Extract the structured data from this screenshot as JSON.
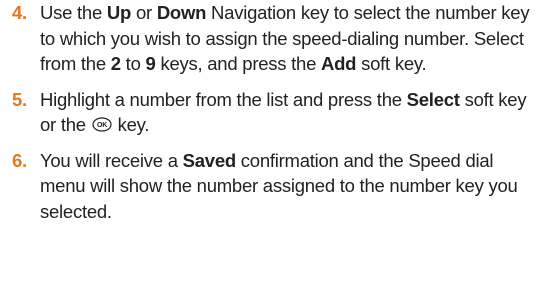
{
  "steps": [
    {
      "number": "4.",
      "parts": [
        {
          "text": "Use the ",
          "bold": false
        },
        {
          "text": "Up",
          "bold": true
        },
        {
          "text": " or ",
          "bold": false
        },
        {
          "text": "Down",
          "bold": true
        },
        {
          "text": " Navigation key to select the number key to which you wish to assign the speed-dialing number. Select from the ",
          "bold": false
        },
        {
          "text": "2",
          "bold": true
        },
        {
          "text": " to ",
          "bold": false
        },
        {
          "text": "9",
          "bold": true
        },
        {
          "text": " keys, and press the ",
          "bold": false
        },
        {
          "text": "Add",
          "bold": true
        },
        {
          "text": " soft key.",
          "bold": false
        }
      ]
    },
    {
      "number": "5.",
      "parts": [
        {
          "text": "Highlight a number from the list and press the ",
          "bold": false
        },
        {
          "text": "Select",
          "bold": true
        },
        {
          "text": " soft key or the ",
          "bold": false
        },
        {
          "icon": "ok-key-icon",
          "label": "OK"
        },
        {
          "text": " key.",
          "bold": false
        }
      ]
    },
    {
      "number": "6.",
      "parts": [
        {
          "text": "You will receive a ",
          "bold": false
        },
        {
          "text": "Saved",
          "bold": true
        },
        {
          "text": " confirmation and the Speed dial menu will show the number assigned to the number key you selected.",
          "bold": false
        }
      ]
    }
  ],
  "colors": {
    "step_number": "#e07a1f",
    "body_text": "#222222"
  }
}
